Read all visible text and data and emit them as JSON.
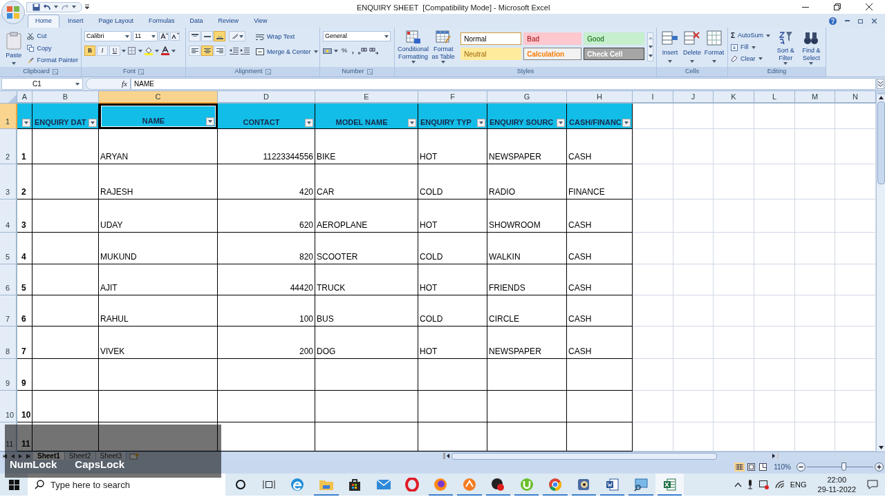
{
  "window": {
    "title": "ENQUIRY SHEET  [Compatibility Mode] - Microsoft Excel"
  },
  "ribbon_tabs": [
    {
      "label": "Home",
      "selected": true
    },
    {
      "label": "Insert",
      "selected": false
    },
    {
      "label": "Page Layout",
      "selected": false
    },
    {
      "label": "Formulas",
      "selected": false
    },
    {
      "label": "Data",
      "selected": false
    },
    {
      "label": "Review",
      "selected": false
    },
    {
      "label": "View",
      "selected": false
    }
  ],
  "clipboard": {
    "label": "Clipboard",
    "paste": "Paste",
    "cut": "Cut",
    "copy": "Copy",
    "format_painter": "Format Painter"
  },
  "font": {
    "label": "Font",
    "font_name": "Calibri",
    "font_size": "11",
    "styles": [
      {
        "label": "B",
        "kind": "bold",
        "on": true
      },
      {
        "label": "I",
        "kind": "italic",
        "on": false
      },
      {
        "label": "U",
        "kind": "underline",
        "on": false
      }
    ]
  },
  "alignment": {
    "label": "Alignment",
    "vertical": [
      {
        "kind": "top",
        "on": false
      },
      {
        "kind": "middle",
        "on": false
      },
      {
        "kind": "bottom",
        "on": true
      }
    ],
    "horizontal": [
      {
        "kind": "left",
        "on": false
      },
      {
        "kind": "center",
        "on": true
      },
      {
        "kind": "right",
        "on": false
      }
    ],
    "wrap_text": "Wrap Text",
    "merge_center": "Merge & Center"
  },
  "number": {
    "label": "Number",
    "format": "General",
    "percent": "%",
    "comma": ","
  },
  "styles": {
    "label": "Styles",
    "conditional_formatting": "Conditional Formatting",
    "format_as_table": "Format as Table",
    "cell_styles": [
      {
        "label": "Normal",
        "kind": "normal"
      },
      {
        "label": "Bad",
        "kind": "bad"
      },
      {
        "label": "Good",
        "kind": "good"
      },
      {
        "label": "Neutral",
        "kind": "neutral"
      },
      {
        "label": "Calculation",
        "kind": "calculation"
      },
      {
        "label": "Check Cell",
        "kind": "check"
      }
    ]
  },
  "cells": {
    "label": "Cells",
    "buttons": [
      {
        "label": "Insert",
        "kind": "insert"
      },
      {
        "label": "Delete",
        "kind": "delete"
      },
      {
        "label": "Format",
        "kind": "format"
      }
    ]
  },
  "editing": {
    "label": "Editing",
    "autosum_symbol": "Σ",
    "autosum": "AutoSum",
    "fill": "Fill",
    "clear": "Clear",
    "sort_filter": "Sort & Filter",
    "find_select": "Find & Select"
  },
  "formula_bar": {
    "name_box": "C1",
    "function_symbol": "fx",
    "value": "NAME"
  },
  "columns": [
    {
      "letter": "A",
      "selected": false
    },
    {
      "letter": "B",
      "selected": false
    },
    {
      "letter": "C",
      "selected": true
    },
    {
      "letter": "D",
      "selected": false
    },
    {
      "letter": "E",
      "selected": false
    },
    {
      "letter": "F",
      "selected": false
    },
    {
      "letter": "G",
      "selected": false
    },
    {
      "letter": "H",
      "selected": false
    },
    {
      "letter": "I",
      "selected": false
    },
    {
      "letter": "J",
      "selected": false
    },
    {
      "letter": "K",
      "selected": false
    },
    {
      "letter": "L",
      "selected": false
    },
    {
      "letter": "M",
      "selected": false
    },
    {
      "letter": "N",
      "selected": false
    }
  ],
  "header_row": {
    "number": "1",
    "selected": true,
    "cells": [
      {
        "text": "ENQUIRY DAT",
        "selected": false
      },
      {
        "text": "NAME",
        "selected": true
      },
      {
        "text": "CONTACT",
        "selected": false
      },
      {
        "text": "MODEL NAME",
        "selected": false
      },
      {
        "text": "ENQUIRY TYP",
        "selected": false
      },
      {
        "text": "ENQUIRY SOURC",
        "selected": false
      },
      {
        "text": "CASH/FINANC",
        "selected": false
      }
    ]
  },
  "rows": [
    {
      "number": "2",
      "selected": false,
      "serial": "1",
      "name": "ARYAN",
      "contact": "11223344556",
      "model_name": "BIKE",
      "enquiry_type": "HOT",
      "enquiry_source": "NEWSPAPER",
      "payment": "CASH"
    },
    {
      "number": "3",
      "selected": false,
      "serial": "2",
      "name": "RAJESH",
      "contact": "420",
      "model_name": "CAR",
      "enquiry_type": "COLD",
      "enquiry_source": "RADIO",
      "payment": "FINANCE"
    },
    {
      "number": "4",
      "selected": false,
      "serial": "3",
      "name": "UDAY",
      "contact": "620",
      "model_name": "AEROPLANE",
      "enquiry_type": "HOT",
      "enquiry_source": "SHOWROOM",
      "payment": "CASH"
    },
    {
      "number": "5",
      "selected": false,
      "serial": "4",
      "name": "MUKUND",
      "contact": "820",
      "model_name": "SCOOTER",
      "enquiry_type": "COLD",
      "enquiry_source": "WALKIN",
      "payment": "CASH"
    },
    {
      "number": "6",
      "selected": false,
      "serial": "5",
      "name": "AJIT",
      "contact": "44420",
      "model_name": "TRUCK",
      "enquiry_type": "HOT",
      "enquiry_source": "FRIENDS",
      "payment": "CASH"
    },
    {
      "number": "7",
      "selected": false,
      "serial": "6",
      "name": "RAHUL",
      "contact": "100",
      "model_name": "BUS",
      "enquiry_type": "COLD",
      "enquiry_source": "CIRCLE",
      "payment": "CASH"
    },
    {
      "number": "8",
      "selected": false,
      "serial": "7",
      "name": "VIVEK",
      "contact": "200",
      "model_name": "DOG",
      "enquiry_type": "HOT",
      "enquiry_source": "NEWSPAPER",
      "payment": "CASH"
    },
    {
      "number": "9",
      "selected": false,
      "serial": "9"
    },
    {
      "number": "10",
      "selected": false,
      "serial": "10"
    },
    {
      "number": "11",
      "selected": false,
      "serial": "11"
    }
  ],
  "sheet_tabs": [
    {
      "label": "Sheet1",
      "selected": true
    },
    {
      "label": "Sheet2",
      "selected": false
    },
    {
      "label": "Sheet3",
      "selected": false
    }
  ],
  "status_bar": {
    "zoom": "110%",
    "level": 0.55
  },
  "key_overlay": [
    "NumLock",
    "CapsLock"
  ],
  "taskbar": {
    "search_placeholder": "Type here to search",
    "apps": [
      {
        "kind": "cortana",
        "running": false,
        "active": false
      },
      {
        "kind": "taskview",
        "running": false,
        "active": false
      },
      {
        "kind": "edge",
        "running": false,
        "active": false
      },
      {
        "kind": "explorer",
        "running": true,
        "active": false
      },
      {
        "kind": "store",
        "running": false,
        "active": false
      },
      {
        "kind": "mail",
        "running": false,
        "active": false
      },
      {
        "kind": "opera",
        "running": false,
        "active": false
      },
      {
        "kind": "firefox",
        "running": true,
        "active": false
      },
      {
        "kind": "orange",
        "running": true,
        "active": false
      },
      {
        "kind": "blackred",
        "running": true,
        "active": false
      },
      {
        "kind": "torrent",
        "running": true,
        "active": false
      },
      {
        "kind": "chrome",
        "running": true,
        "active": false
      },
      {
        "kind": "media",
        "running": true,
        "active": false
      },
      {
        "kind": "word",
        "running": true,
        "active": false
      },
      {
        "kind": "screen",
        "running": true,
        "active": false
      },
      {
        "kind": "excel",
        "running": true,
        "active": true
      }
    ],
    "language": "ENG",
    "time": "22:00",
    "date": "29-11-2022"
  }
}
